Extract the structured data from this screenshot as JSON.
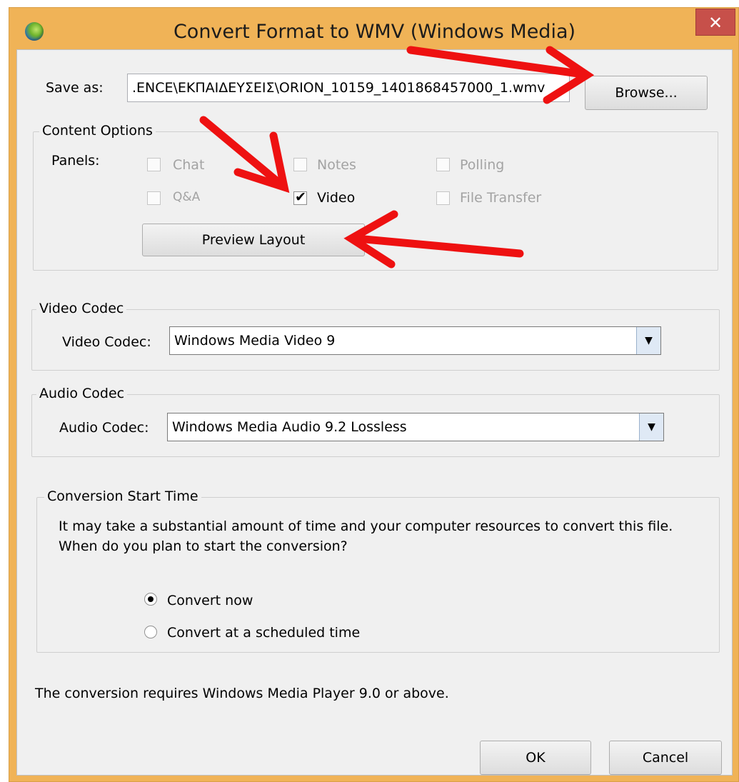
{
  "window": {
    "title": "Convert Format to WMV (Windows Media)",
    "close_glyph": "✕",
    "app_icon": "globe-icon"
  },
  "save_as": {
    "label": "Save as:",
    "path": ".ENCE\\ΕΚΠΑΙΔΕΥΣΕΙΣ\\ORION_10159_1401868457000_1.wmv",
    "browse_label": "Browse..."
  },
  "content_options": {
    "title": "Content Options",
    "panels_label": "Panels:",
    "panels": [
      {
        "label": "Chat",
        "checked": false,
        "enabled": false
      },
      {
        "label": "Notes",
        "checked": false,
        "enabled": false
      },
      {
        "label": "Polling",
        "checked": false,
        "enabled": false
      },
      {
        "label": "Q&A",
        "checked": false,
        "enabled": false
      },
      {
        "label": "Video",
        "checked": true,
        "enabled": true
      },
      {
        "label": "File Transfer",
        "checked": false,
        "enabled": false
      }
    ],
    "preview_label": "Preview Layout"
  },
  "video_codec": {
    "title": "Video Codec",
    "label": "Video Codec:",
    "value": "Windows Media Video 9"
  },
  "audio_codec": {
    "title": "Audio Codec",
    "label": "Audio Codec:",
    "value": "Windows Media Audio 9.2 Lossless"
  },
  "start_time": {
    "title": "Conversion Start Time",
    "description_line1": "It may take a substantial amount of time and your computer resources to convert this file.",
    "description_line2": "When do you plan to start the conversion?",
    "options": [
      {
        "label": "Convert now",
        "selected": true
      },
      {
        "label": "Convert at a scheduled time",
        "selected": false
      }
    ]
  },
  "footer": {
    "note": "The conversion requires Windows Media Player 9.0 or above.",
    "ok_label": "OK",
    "cancel_label": "Cancel"
  },
  "colors": {
    "title_bar": "#f0b357",
    "close_button": "#c7504a",
    "dialog_background": "#f0f0f0",
    "annotation_arrow": "#ee1111"
  }
}
